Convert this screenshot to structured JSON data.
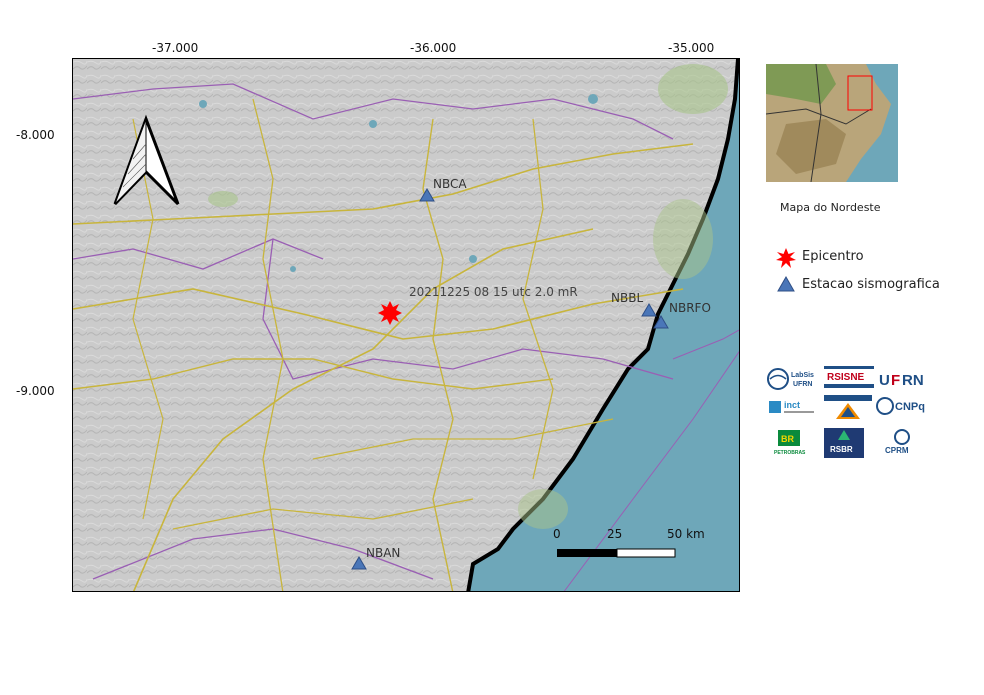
{
  "axes": {
    "lon_ticks": [
      "-37.000",
      "-36.000",
      "-35.000"
    ],
    "lat_ticks": [
      "-8.000",
      "-9.000"
    ]
  },
  "event_label": "20211225 08 15 utc 2.0 mR",
  "stations": [
    {
      "code": "NBCA"
    },
    {
      "code": "NBBL"
    },
    {
      "code": "NBRFO"
    },
    {
      "code": "NBAN"
    }
  ],
  "scalebar": {
    "labels": [
      "0",
      "25",
      "50 km"
    ]
  },
  "inset": {
    "caption": "Mapa do Nordeste"
  },
  "legend": {
    "epicenter_label": "Epicentro",
    "station_label": "Estacao sismografica"
  },
  "logos": [
    "LabSis UFRN",
    "RSISNE",
    "UFRN",
    "inct",
    "CNPq",
    "BR PETROBRAS",
    "RSBR",
    "CPRM"
  ],
  "colors": {
    "ocean": "#6ea7b9",
    "land": "#c9c9c9",
    "roads": "#c8b53c",
    "borders": "#9a5fb4",
    "station_marker": "#4a76b8",
    "epicenter_marker": "#ff0000"
  }
}
